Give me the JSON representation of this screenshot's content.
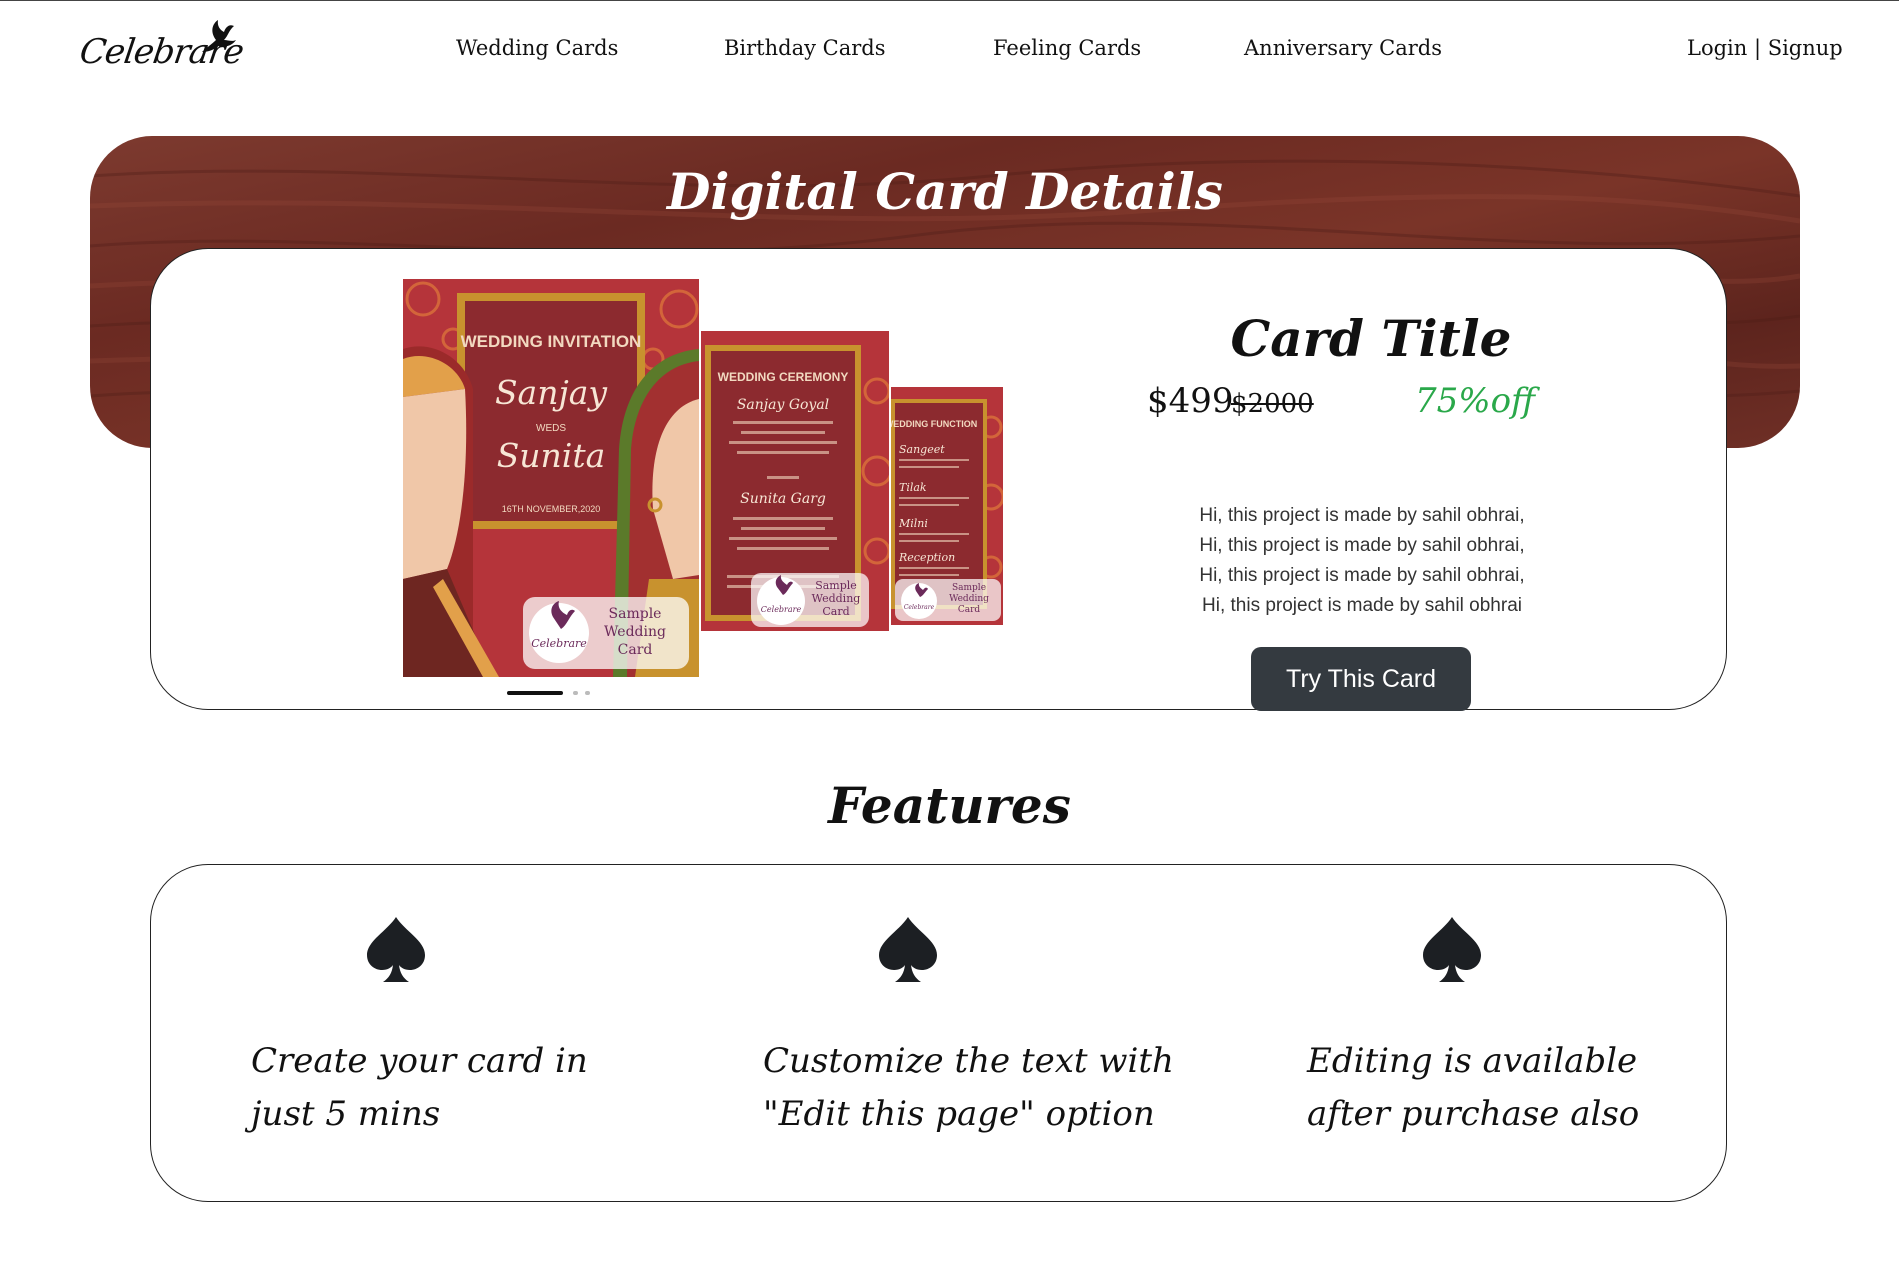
{
  "brand": {
    "logo_text": "Celebrare",
    "logo_icon": "dove-icon"
  },
  "nav": {
    "links": [
      {
        "label": "Wedding Cards"
      },
      {
        "label": "Birthday Cards"
      },
      {
        "label": "Feeling Cards"
      },
      {
        "label": "Anniversary Cards"
      }
    ],
    "auth_label": "Login | Signup"
  },
  "hero": {
    "title": "Digital Card Details"
  },
  "card_images": [
    {
      "heading": "WEDDING INVITATION",
      "name1": "Sanjay",
      "weds": "WEDS",
      "name2": "Sunita",
      "date": "16TH NOVEMBER,2020",
      "badge_logo": "Celebrare",
      "badge_text": "Sample Wedding Card"
    },
    {
      "heading": "WEDDING CEREMONY",
      "name1": "Sanjay Goyal",
      "name2": "Sunita Garg",
      "badge_logo": "Celebrare",
      "badge_text": "Sample Wedding Card"
    },
    {
      "heading": "WEDDING FUNCTION",
      "events": [
        "Sangeet",
        "Tilak",
        "Milni",
        "Reception"
      ],
      "badge_logo": "Celebrare",
      "badge_text": "Sample Wedding Card"
    }
  ],
  "carousel": {
    "slides": 3,
    "active_index": 0
  },
  "details": {
    "title": "Card Title",
    "price": "$499",
    "original_price": "$2000",
    "discount": "75%off",
    "description_lines": [
      "Hi, this project is made by sahil obhrai,",
      "Hi, this project is made by sahil obhrai,",
      "Hi, this project is made by sahil obhrai,",
      "Hi, this project is made by sahil obhrai"
    ],
    "cta_label": "Try This Card"
  },
  "features": {
    "title": "Features",
    "items": [
      {
        "icon": "spade-icon",
        "line1": "Create your card in",
        "line2": "just 5 mins"
      },
      {
        "icon": "spade-icon",
        "line1": "Customize the text with",
        "line2": "\"Edit this page\" option"
      },
      {
        "icon": "spade-icon",
        "line1": "Editing is available",
        "line2": "after purchase also"
      }
    ]
  },
  "colors": {
    "hero_wood": "#6b2a22",
    "card_maroon": "#8c2a2f",
    "card_gold": "#c8922e",
    "button_dark": "#343a40",
    "discount_green": "#2aa84a"
  }
}
